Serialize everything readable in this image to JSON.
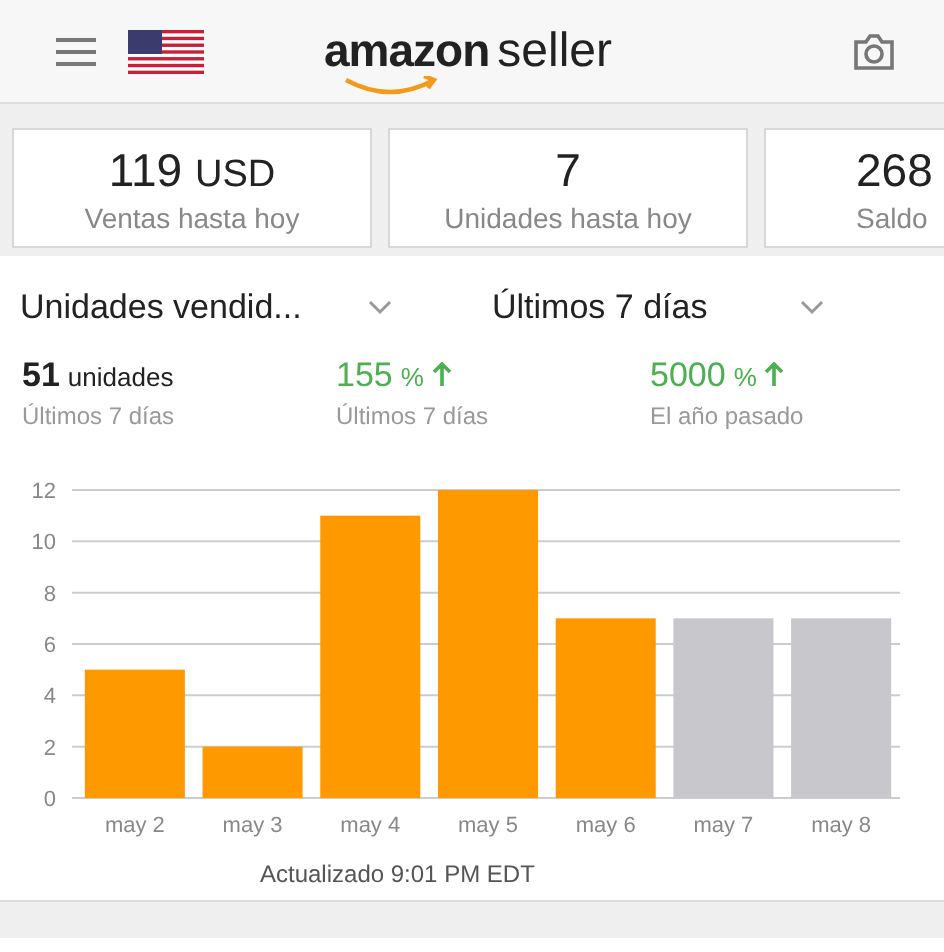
{
  "header": {
    "logo": {
      "brand": "amazon",
      "product": "seller"
    }
  },
  "cards": [
    {
      "value": "119",
      "unit": "USD",
      "label": "Ventas hasta hoy"
    },
    {
      "value": "7",
      "label": "Unidades hasta hoy"
    },
    {
      "value": "268",
      "label": "Saldo"
    }
  ],
  "filters": [
    {
      "label": "Unidades vendid..."
    },
    {
      "label": "Últimos 7 días"
    }
  ],
  "stats": [
    {
      "value": "51",
      "unit": "unidades",
      "label": "Últimos 7 días",
      "kind": "plain"
    },
    {
      "value": "155",
      "unit": "%",
      "label": "Últimos 7 días",
      "kind": "up"
    },
    {
      "value": "5000",
      "unit": "%",
      "label": "El año pasado",
      "kind": "up"
    }
  ],
  "chart": {
    "chart_data": {
      "type": "bar",
      "grid": true,
      "categories": [
        "may 2",
        "may 3",
        "may 4",
        "may 5",
        "may 6",
        "may 7",
        "may 8"
      ],
      "series": [
        {
          "color": "#ff9900",
          "values": [
            5,
            2,
            11,
            12,
            7,
            null,
            null
          ]
        },
        {
          "color": "#c7c7cc",
          "values": [
            null,
            null,
            null,
            null,
            null,
            7,
            7
          ]
        }
      ],
      "ylim": [
        0,
        12
      ],
      "yticks": [
        0,
        2,
        4,
        6,
        8,
        10,
        12
      ]
    }
  },
  "updated": "Actualizado 9:01 PM EDT"
}
